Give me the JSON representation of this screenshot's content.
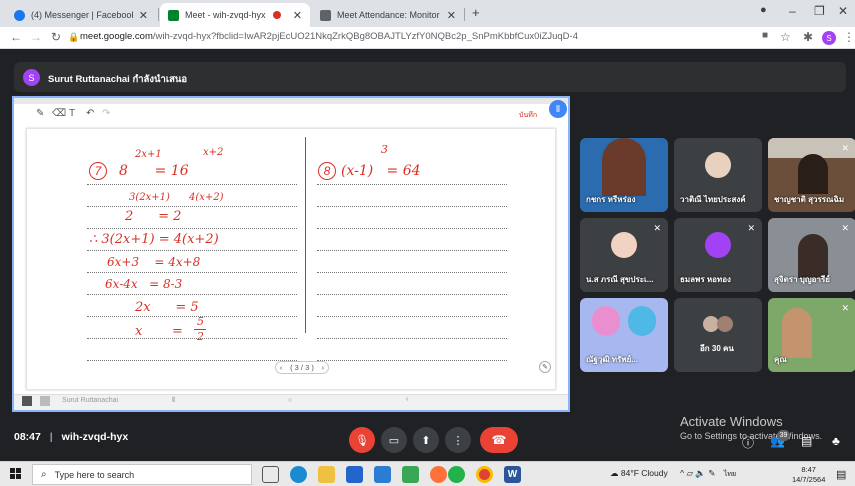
{
  "browser": {
    "tabs": [
      {
        "label": "(4) Messenger | Facebook",
        "favicon_color": "#1877f2",
        "favicon": "facebook-icon"
      },
      {
        "label": "Meet - wih-zvqd-hyx",
        "favicon_color": "#00832d",
        "favicon": "meet-icon",
        "recording": true
      },
      {
        "label": "Meet Attendance: Monitor",
        "favicon_color": "#5f6368",
        "favicon": "extension-icon"
      }
    ],
    "new_tab": "+",
    "url_host": "meet.google.com",
    "url_path": "/wih-zvqd-hyx?fbclid=IwAR2pjEcUO21NkqZrkQBg8OBAJTLYzfY0NQBc2p_SnPmKbbfCux0iZJuqD-4",
    "profile_initial": "S"
  },
  "meet": {
    "presenter_initial": "S",
    "presenter_text": "Surut Ruttanachai กำลังนำเสนอ",
    "time": "08:47",
    "meeting_code": "wih-zvqd-hyx",
    "participant_badge": "39"
  },
  "whiteboard": {
    "save_label": "บันทึก",
    "page_indicator": "( 3 / 3 )",
    "footer_name": "Surut Ruttanachai",
    "problem7": {
      "number": "7",
      "line0_exp1": "2x+1",
      "line0_exp2": "x+2",
      "line1": "8      = 16",
      "line2": "3(2x+1)      4(x+2)",
      "line3": "2      = 2",
      "line4": "∴ 3(2x+1) = 4(x+2)",
      "line5": "6x+3    = 4x+8",
      "line6": "6x-4x   = 8-3",
      "line7": "2x      = 5",
      "line8_lhs": "x",
      "line8_eq": "=",
      "line8_num": "5",
      "line8_den": "2"
    },
    "problem8": {
      "number": "8",
      "exponent": "3",
      "expr": "(x-1)   = 64"
    }
  },
  "participants": [
    {
      "name": "กชกร หรีหร่อง",
      "muted": false,
      "tile_color": "#2b6cb0",
      "type": "video"
    },
    {
      "name": "วาติณี ไทยประสงค์",
      "muted": false,
      "tile_color": "#3c4043",
      "type": "avatar"
    },
    {
      "name": "ชาญชาติ สุวรรณฉิม",
      "muted": true,
      "tile_color": "#6b4f3a",
      "type": "video"
    },
    {
      "name": "น.ส ภรณี สุขประเ...",
      "muted": true,
      "tile_color": "#3c4043",
      "type": "avatar"
    },
    {
      "name": "ธมลพร หอทอง",
      "muted": true,
      "tile_color": "#3c4043",
      "type": "default-avatar"
    },
    {
      "name": "สุจิตรา บุญอารีย์",
      "muted": true,
      "tile_color": "#8a8f95",
      "type": "video"
    },
    {
      "name": "ณัฐวุฒิ ทรัพย์...",
      "muted": false,
      "tile_color": "#a7b8f0",
      "type": "video"
    },
    {
      "name": "อีก 30 คน",
      "muted": false,
      "tile_color": "#3c4043",
      "type": "more"
    },
    {
      "name": "คุณ",
      "muted": true,
      "tile_color": "#7ea86a",
      "type": "video"
    }
  ],
  "activate": {
    "title": "Activate Windows",
    "subtitle": "Go to Settings to activate Windows."
  },
  "taskbar": {
    "search_placeholder": "Type here to search",
    "weather": "84°F  Cloudy",
    "lang": "ไทย",
    "time": "8:47",
    "date": "14/7/2564"
  }
}
